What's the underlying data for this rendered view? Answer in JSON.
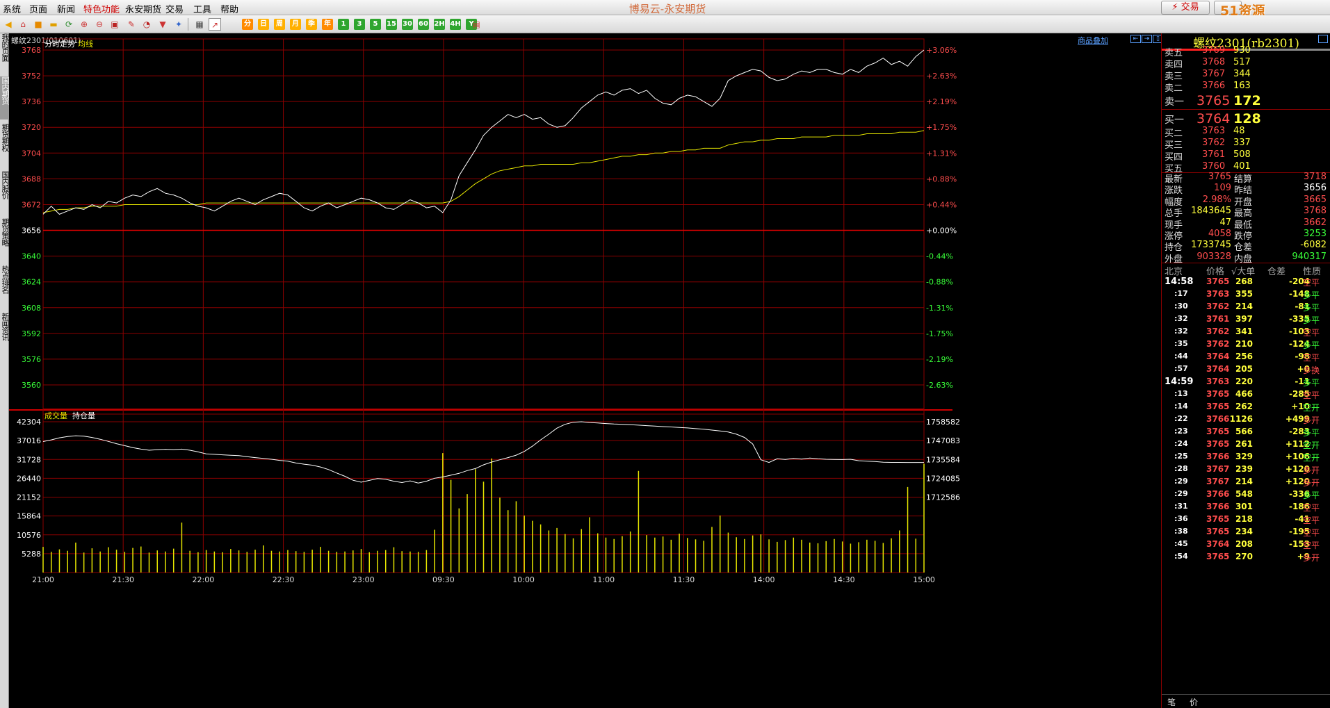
{
  "menus": [
    "系统",
    "页面",
    "新闻",
    "特色功能",
    "永安期货",
    "交易",
    "工具",
    "帮助"
  ],
  "app_title": "博易云-永安期货",
  "trade_button": "⚡ 交易",
  "watermark": "51资源5etz.com",
  "toolbar_boxes": [
    {
      "label": "分",
      "color": "#ff8a00"
    },
    {
      "label": "日",
      "color": "#ffb000"
    },
    {
      "label": "周",
      "color": "#ffb000"
    },
    {
      "label": "月",
      "color": "#ffb000"
    },
    {
      "label": "季",
      "color": "#ffb000"
    },
    {
      "label": "年",
      "color": "#ff8a00"
    },
    {
      "label": "1",
      "color": "#2fa52f"
    },
    {
      "label": "3",
      "color": "#2fa52f"
    },
    {
      "label": "5",
      "color": "#2fa52f"
    },
    {
      "label": "15",
      "color": "#2fa52f"
    },
    {
      "label": "30",
      "color": "#2fa52f"
    },
    {
      "label": "60",
      "color": "#2fa52f"
    },
    {
      "label": "2H",
      "color": "#2fa52f"
    },
    {
      "label": "4H",
      "color": "#2fa52f"
    },
    {
      "label": "Y",
      "color": "#2fa52f"
    }
  ],
  "left_tabs": [
    {
      "label": "我的页面",
      "active": false
    },
    {
      "label": "国内期货",
      "active": true
    },
    {
      "label": "期货期权",
      "active": false
    },
    {
      "label": "国内股价",
      "active": false
    },
    {
      "label": "期货策略",
      "active": false
    },
    {
      "label": "热点排名",
      "active": false
    },
    {
      "label": "新闻资讯",
      "active": false
    }
  ],
  "chart_title": "螺纹2301(010601)",
  "add_goods": "商品叠加",
  "price_panel_labels": {
    "minute": "分时走势",
    "avg": "均线"
  },
  "volume_panel_labels": {
    "vol": "成交量",
    "oi": "持仓量"
  },
  "colors": {
    "price": "#ffffff",
    "avg": "#e6e600",
    "grid": "#8b0000",
    "up": "#ff4d4d",
    "down": "#39ff39",
    "vol": "#e6e600"
  },
  "chart_data": [
    {
      "type": "line",
      "title": "",
      "x_labels": [
        "21:00",
        "21:30",
        "22:00",
        "22:30",
        "23:00",
        "09:30",
        "10:00",
        "11:00",
        "11:30",
        "14:00",
        "14:30",
        "15:00"
      ],
      "y_ticks": [
        3768,
        3752,
        3736,
        3720,
        3704,
        3688,
        3672,
        3656,
        3640,
        3624,
        3608,
        3592,
        3576,
        3560
      ],
      "pct_ticks": [
        "+3.06%",
        "+2.63%",
        "+2.19%",
        "+1.75%",
        "+1.31%",
        "+0.88%",
        "+0.44%",
        "+0.00%",
        "-0.44%",
        "-0.88%",
        "-1.31%",
        "-1.75%",
        "-2.19%",
        "-2.63%"
      ],
      "pre_settle": 3656,
      "series": [
        {
          "name": "分时走势",
          "values": [
            3666,
            3671,
            3666,
            3668,
            3670,
            3669,
            3672,
            3670,
            3674,
            3673,
            3676,
            3678,
            3677,
            3680,
            3682,
            3679,
            3678,
            3676,
            3673,
            3671,
            3670,
            3668,
            3671,
            3674,
            3676,
            3674,
            3672,
            3675,
            3677,
            3679,
            3678,
            3674,
            3670,
            3668,
            3671,
            3673,
            3670,
            3672,
            3674,
            3676,
            3675,
            3673,
            3670,
            3669,
            3672,
            3675,
            3673,
            3670,
            3671,
            3667,
            3675,
            3690,
            3698,
            3706,
            3715,
            3720,
            3724,
            3728,
            3726,
            3728,
            3725,
            3726,
            3722,
            3720,
            3721,
            3726,
            3732,
            3736,
            3740,
            3742,
            3740,
            3743,
            3744,
            3741,
            3743,
            3738,
            3735,
            3734,
            3738,
            3740,
            3739,
            3736,
            3733,
            3738,
            3749,
            3752,
            3754,
            3756,
            3755,
            3751,
            3749,
            3750,
            3753,
            3755,
            3754,
            3756,
            3756,
            3754,
            3753,
            3756,
            3754,
            3758,
            3760,
            3763,
            3759,
            3761,
            3758,
            3764,
            3768
          ]
        },
        {
          "name": "均线",
          "values": [
            3667,
            3668,
            3669,
            3669,
            3670,
            3670,
            3671,
            3671,
            3671,
            3671,
            3672,
            3672,
            3672,
            3672,
            3672,
            3672,
            3672,
            3672,
            3672,
            3672,
            3673,
            3673,
            3673,
            3673,
            3673,
            3673,
            3673,
            3673,
            3673,
            3673,
            3673,
            3673,
            3673,
            3673,
            3673,
            3673,
            3673,
            3673,
            3673,
            3673,
            3673,
            3673,
            3673,
            3673,
            3673,
            3673,
            3673,
            3673,
            3673,
            3673,
            3674,
            3677,
            3681,
            3685,
            3688,
            3691,
            3693,
            3694,
            3695,
            3696,
            3696,
            3697,
            3697,
            3697,
            3697,
            3697,
            3698,
            3698,
            3699,
            3700,
            3701,
            3702,
            3702,
            3703,
            3703,
            3704,
            3704,
            3705,
            3705,
            3706,
            3706,
            3707,
            3707,
            3707,
            3709,
            3710,
            3711,
            3711,
            3712,
            3712,
            3713,
            3713,
            3713,
            3714,
            3714,
            3714,
            3714,
            3715,
            3715,
            3715,
            3715,
            3716,
            3716,
            3716,
            3716,
            3717,
            3717,
            3717,
            3718
          ]
        }
      ]
    },
    {
      "type": "bar",
      "title": "",
      "y_ticks": [
        42304,
        37016,
        31728,
        26440,
        21152,
        15864,
        10576,
        5288
      ],
      "oi_ticks": [
        1758582,
        1747083,
        1735584,
        1724085,
        1712586
      ],
      "series": [
        {
          "name": "成交量",
          "values": [
            7200,
            5800,
            6500,
            6100,
            8400,
            5600,
            6800,
            5900,
            7100,
            6400,
            5800,
            6900,
            7300,
            5600,
            6200,
            5900,
            6700,
            14000,
            6100,
            5700,
            6300,
            5900,
            5700,
            6600,
            6200,
            5800,
            6400,
            7600,
            6100,
            5900,
            6300,
            6000,
            5800,
            6400,
            7200,
            6100,
            5800,
            5900,
            6200,
            6600,
            5700,
            6100,
            6300,
            7100,
            6000,
            5900,
            5800,
            6300,
            12000,
            33500,
            26000,
            18000,
            22000,
            29000,
            25500,
            32000,
            21000,
            17500,
            20000,
            16000,
            14500,
            13500,
            11800,
            12500,
            10800,
            9600,
            12200,
            15500,
            11000,
            9800,
            9400,
            10200,
            11500,
            28500,
            10500,
            9800,
            10100,
            9200,
            10900,
            9700,
            9300,
            8900,
            12800,
            16000,
            11200,
            9900,
            9400,
            10400,
            10700,
            9300,
            8600,
            9100,
            9800,
            9200,
            8400,
            8200,
            8800,
            9400,
            8700,
            8100,
            8500,
            9200,
            8900,
            8300,
            9600,
            11800,
            24000,
            9500,
            30500
          ]
        },
        {
          "name": "持仓量",
          "values": [
            1746500,
            1747500,
            1748800,
            1749600,
            1750000,
            1749800,
            1749000,
            1747900,
            1746600,
            1745200,
            1744000,
            1742800,
            1741900,
            1741200,
            1741500,
            1741800,
            1741600,
            1741900,
            1741200,
            1740200,
            1739000,
            1738700,
            1738400,
            1738100,
            1737900,
            1737300,
            1736700,
            1736200,
            1735700,
            1735000,
            1734500,
            1733400,
            1732700,
            1732100,
            1731000,
            1729400,
            1727300,
            1725300,
            1722900,
            1721700,
            1722800,
            1723900,
            1723500,
            1722300,
            1721500,
            1722500,
            1721200,
            1722300,
            1724100,
            1724900,
            1726000,
            1727100,
            1728800,
            1730000,
            1732300,
            1734000,
            1735400,
            1736700,
            1738200,
            1740500,
            1743700,
            1747500,
            1751000,
            1754700,
            1757000,
            1758300,
            1758600,
            1758100,
            1757800,
            1757500,
            1757200,
            1757000,
            1756800,
            1756500,
            1756200,
            1755900,
            1755600,
            1755400,
            1755100,
            1754800,
            1754400,
            1754000,
            1753500,
            1753000,
            1752300,
            1751000,
            1749000,
            1745000,
            1735400,
            1733745,
            1736000,
            1735600,
            1736200,
            1735800,
            1736400,
            1736000,
            1735700,
            1735600,
            1735500,
            1735700,
            1734800,
            1734500,
            1734300,
            1733900,
            1733800,
            1733800,
            1733745,
            1733745,
            1733745
          ]
        }
      ]
    }
  ],
  "right_panel": {
    "title": "螺纹2301(rb2301)",
    "asks": [
      {
        "label": "卖五",
        "price": "3769",
        "vol": "930"
      },
      {
        "label": "卖四",
        "price": "3768",
        "vol": "517"
      },
      {
        "label": "卖三",
        "price": "3767",
        "vol": "344"
      },
      {
        "label": "卖二",
        "price": "3766",
        "vol": "163"
      }
    ],
    "ask1": {
      "label": "卖一",
      "price": "3765",
      "vol": "172"
    },
    "bid1": {
      "label": "买一",
      "price": "3764",
      "vol": "128"
    },
    "bids": [
      {
        "label": "买二",
        "price": "3763",
        "vol": "48"
      },
      {
        "label": "买三",
        "price": "3762",
        "vol": "337"
      },
      {
        "label": "买四",
        "price": "3761",
        "vol": "508"
      },
      {
        "label": "买五",
        "price": "3760",
        "vol": "401"
      }
    ],
    "stats": [
      {
        "l1": "最新",
        "v1": "3765",
        "c1": "red",
        "l2": "结算",
        "v2": "3718",
        "c2": "red"
      },
      {
        "l1": "涨跌",
        "v1": "109",
        "c1": "red",
        "l2": "昨结",
        "v2": "3656",
        "c2": "wht"
      },
      {
        "l1": "幅度",
        "v1": "2.98%",
        "c1": "red",
        "l2": "开盘",
        "v2": "3665",
        "c2": "red"
      },
      {
        "l1": "总手",
        "v1": "1843645",
        "c1": "yel",
        "l2": "最高",
        "v2": "3768",
        "c2": "red"
      },
      {
        "l1": "现手",
        "v1": "47",
        "c1": "yel",
        "l2": "最低",
        "v2": "3662",
        "c2": "red"
      },
      {
        "l1": "涨停",
        "v1": "4058",
        "c1": "red",
        "l2": "跌停",
        "v2": "3253",
        "c2": "grn"
      },
      {
        "l1": "持仓",
        "v1": "1733745",
        "c1": "yel",
        "l2": "仓差",
        "v2": "-6082",
        "c2": "yel"
      },
      {
        "l1": "外盘",
        "v1": "903328",
        "c1": "red",
        "l2": "内盘",
        "v2": "940317",
        "c2": "grn"
      }
    ],
    "tick_header": {
      "loc": "北京",
      "price": "价格",
      "vol": "√大单",
      "oi": "仓差",
      "nature": "性质"
    },
    "ticks": [
      {
        "t": "14:58",
        "p": "3765",
        "pc": "red",
        "v": "268",
        "d": "-204",
        "n": "空平",
        "nc": "red",
        "big": true
      },
      {
        "t": ":17",
        "p": "3763",
        "pc": "red",
        "v": "355",
        "d": "-148",
        "n": "多平",
        "nc": "grn"
      },
      {
        "t": ":30",
        "p": "3762",
        "pc": "red",
        "v": "214",
        "d": "-81",
        "n": "多平",
        "nc": "grn"
      },
      {
        "t": ":32",
        "p": "3761",
        "pc": "red",
        "v": "397",
        "d": "-335",
        "n": "多平",
        "nc": "grn"
      },
      {
        "t": ":32",
        "p": "3762",
        "pc": "red",
        "v": "341",
        "d": "-103",
        "n": "空平",
        "nc": "red"
      },
      {
        "t": ":35",
        "p": "3762",
        "pc": "red",
        "v": "210",
        "d": "-124",
        "n": "多平",
        "nc": "grn"
      },
      {
        "t": ":44",
        "p": "3764",
        "pc": "red",
        "v": "256",
        "d": "-98",
        "n": "空平",
        "nc": "red"
      },
      {
        "t": ":57",
        "p": "3764",
        "pc": "red",
        "v": "205",
        "d": "+0",
        "n": "多换",
        "nc": "red"
      },
      {
        "t": "14:59",
        "p": "3763",
        "pc": "red",
        "v": "220",
        "d": "-11",
        "n": "多平",
        "nc": "grn",
        "big": true
      },
      {
        "t": ":13",
        "p": "3765",
        "pc": "red",
        "v": "466",
        "d": "-285",
        "n": "空平",
        "nc": "red"
      },
      {
        "t": ":14",
        "p": "3765",
        "pc": "red",
        "v": "262",
        "d": "+10",
        "n": "空开",
        "nc": "grn"
      },
      {
        "t": ":22",
        "p": "3766",
        "pc": "red",
        "v": "1126",
        "d": "+499",
        "n": "多开",
        "nc": "red"
      },
      {
        "t": ":23",
        "p": "3765",
        "pc": "red",
        "v": "566",
        "d": "-283",
        "n": "多平",
        "nc": "grn"
      },
      {
        "t": ":24",
        "p": "3765",
        "pc": "red",
        "v": "261",
        "d": "+112",
        "n": "空开",
        "nc": "grn"
      },
      {
        "t": ":25",
        "p": "3766",
        "pc": "red",
        "v": "329",
        "d": "+106",
        "n": "空开",
        "nc": "grn"
      },
      {
        "t": ":28",
        "p": "3767",
        "pc": "red",
        "v": "239",
        "d": "+120",
        "n": "多开",
        "nc": "red"
      },
      {
        "t": ":29",
        "p": "3767",
        "pc": "red",
        "v": "214",
        "d": "+120",
        "n": "多开",
        "nc": "red"
      },
      {
        "t": ":29",
        "p": "3766",
        "pc": "red",
        "v": "548",
        "d": "-336",
        "n": "多平",
        "nc": "grn"
      },
      {
        "t": ":31",
        "p": "3766",
        "pc": "red",
        "v": "301",
        "d": "-186",
        "n": "空平",
        "nc": "red"
      },
      {
        "t": ":36",
        "p": "3765",
        "pc": "red",
        "v": "218",
        "d": "-41",
        "n": "空平",
        "nc": "red"
      },
      {
        "t": ":38",
        "p": "3765",
        "pc": "red",
        "v": "234",
        "d": "-195",
        "n": "空平",
        "nc": "red"
      },
      {
        "t": ":45",
        "p": "3764",
        "pc": "red",
        "v": "208",
        "d": "-153",
        "n": "空平",
        "nc": "red"
      },
      {
        "t": ":54",
        "p": "3765",
        "pc": "red",
        "v": "270",
        "d": "+9",
        "n": "多开",
        "nc": "red"
      }
    ],
    "bottom_tabs": [
      "笔",
      "价"
    ]
  }
}
